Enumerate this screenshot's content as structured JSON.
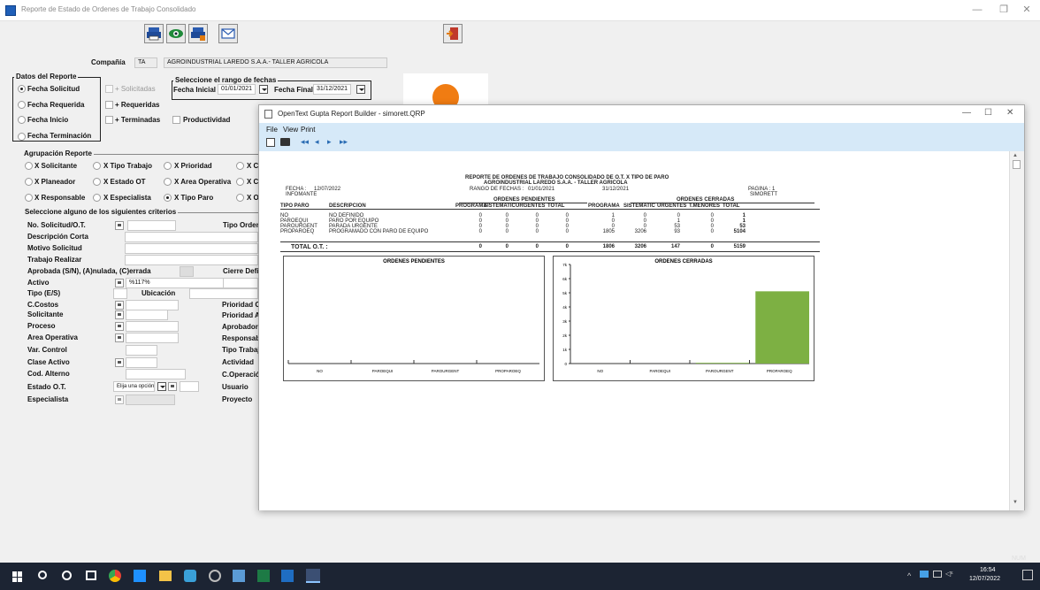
{
  "window": {
    "title": "Reporte de Estado de Ordenes de Trabajo Consolidado"
  },
  "toolbar": {
    "icons": [
      "printer-icon",
      "preview-eye-icon",
      "print-setup-icon",
      "mail-icon",
      "exit-door-icon"
    ]
  },
  "company": {
    "label": "Compañía",
    "code": "TA",
    "name": "AGROINDUSTRIAL LAREDO S.A.A.- TALLER AGRICOLA"
  },
  "datos_reporte": {
    "title": "Datos del Reporte",
    "options": [
      "Fecha Solicitud",
      "Fecha Requerida",
      "Fecha Inicio",
      "Fecha Terminación"
    ],
    "checks": [
      "+ Solicitadas",
      "+ Requeridas",
      "+ Terminadas"
    ],
    "productividad": "Productividad"
  },
  "rango": {
    "title": "Seleccione el rango de fechas",
    "inicial_label": "Fecha Inicial",
    "inicial": "01/01/2021",
    "final_label": "Fecha Final",
    "final": "31/12/2021"
  },
  "agrupacion": {
    "title": "Agrupación Reporte",
    "row1": [
      "X Solicitante",
      "X Tipo Trabajo",
      "X Prioridad",
      "X C.C"
    ],
    "row2": [
      "X Planeador",
      "X Estado OT",
      "X Area Operativa",
      "X C."
    ],
    "row3": [
      "X Responsable",
      "X Especialista",
      "X Tipo Paro",
      "X Op"
    ]
  },
  "criterios": {
    "title": "Seleccione alguno de los siguientes criterios",
    "left": [
      "No. Solicitud/O.T.",
      "Descripción Corta",
      "Motivo Solicitud",
      "Trabajo Realizar",
      "Aprobada (S/N), (A)nulada, (C)errada",
      "Activo",
      "Tipo (E/S)",
      "C.Costos",
      "Solicitante",
      "Proceso",
      "Area Operativa",
      "Var. Control",
      "Clase Activo",
      "Cod. Alterno",
      "Estado O.T.",
      "Especialista"
    ],
    "right": [
      "Tipo Orden (",
      "Cierre Defin",
      "Prioridad O.",
      "Prioridad Ac",
      "Aprobador",
      "Responsab",
      "Tipo Trabajo",
      "Actividad",
      "C.Operación",
      "Usuario",
      "Proyecto"
    ],
    "ubicacion": "Ubicación",
    "activo_value": "%117%",
    "estado_placeholder": "Elija una opción"
  },
  "rb": {
    "title": "OpenText Gupta Report Builder - simorett.QRP",
    "menu": [
      "File",
      "View",
      "Print"
    ],
    "nav": [
      "◂◂",
      "◂",
      "▸",
      "▸▸"
    ]
  },
  "report": {
    "title1": "REPORTE DE ORDENES DE TRABAJO CONSOLIDADO DE O.T. X TIPO DE PARO",
    "title2": "AGROINDUSTRIAL LAREDO S.A.A. - TALLER AGRICOLA",
    "fecha_label": "FECHA :",
    "fecha": "12/07/2022",
    "infomante": "INFOMANTE",
    "rango_label": "RANGO DE FECHAS :",
    "rango_ini": "01/01/2021",
    "rango_fin": "31/12/2021",
    "pagina_label": "PAGINA :",
    "pagina": "1",
    "user": "SIMORETT",
    "pend_header": "ORDENES PENDIENTES",
    "cerr_header": "ORDENES CERRADAS",
    "columns": [
      "TIPO PARO",
      "DESCRIPCION",
      "PROGRAMA",
      "SISTEMATIC",
      "URGENTES",
      "TOTAL",
      "PROGRAMA",
      "SISTEMATIC",
      "URGENTES",
      "T.MENORES",
      "TOTAL"
    ],
    "rows": [
      [
        "NO",
        "NO DEFINIDO",
        "0",
        "0",
        "0",
        "0",
        "1",
        "0",
        "0",
        "0",
        "1"
      ],
      [
        "PAROEQUI",
        "PARO POR EQUIPO",
        "0",
        "0",
        "0",
        "0",
        "0",
        "0",
        "1",
        "0",
        "1"
      ],
      [
        "PAROURGENT",
        "PARADA URGENTE",
        "0",
        "0",
        "0",
        "0",
        "0",
        "0",
        "53",
        "0",
        "53"
      ],
      [
        "PROPAROEQ",
        "PROGRAMADO CON PARO DE EQUIPO",
        "0",
        "0",
        "0",
        "0",
        "1805",
        "3206",
        "93",
        "0",
        "5104"
      ]
    ],
    "total_label": "TOTAL O.T. :",
    "totals": [
      "0",
      "0",
      "0",
      "0",
      "1806",
      "3206",
      "147",
      "0",
      "5159"
    ]
  },
  "chart_data": [
    {
      "type": "bar",
      "title": "ORDENES PENDIENTES",
      "categories": [
        "NO",
        "PAROEQUI",
        "PAROURGENT",
        "PROPAROEQ"
      ],
      "values": [
        0,
        0,
        0,
        0
      ]
    },
    {
      "type": "bar",
      "title": "ORDENES CERRADAS",
      "categories": [
        "NO",
        "PAROEQUI",
        "PAROURGENT",
        "PROPAROEQ"
      ],
      "values": [
        1,
        1,
        53,
        5104
      ],
      "yticks": [
        "0",
        "1k",
        "2k",
        "3k",
        "4k",
        "5k",
        "6k",
        "7k"
      ],
      "ylim": [
        0,
        7000
      ],
      "bar_color": "#7db043"
    }
  ],
  "status": {
    "num": "NUM",
    "time": "16:54",
    "date": "12/07/2022"
  },
  "taskbar": {
    "icons": [
      "windows-start-icon",
      "search-icon",
      "cortana-icon",
      "task-view-icon",
      "chrome-icon",
      "app-icon",
      "file-explorer-icon",
      "app-icon-2",
      "app-icon-3",
      "app-icon-4",
      "excel-icon",
      "outlook-icon",
      "report-app-icon"
    ]
  }
}
